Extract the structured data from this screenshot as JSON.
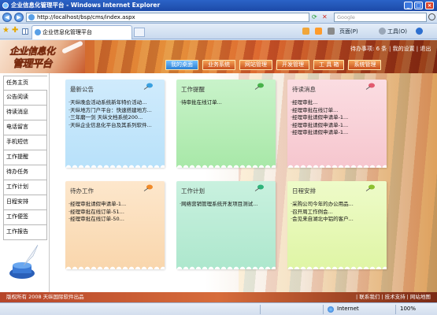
{
  "window": {
    "title": "企业信息化管理平台 - Windows Internet Explorer",
    "address": "http://localhost/bsp/cms/index.aspx",
    "search_placeholder": "Google",
    "tab_title": "企业信息化管理平台",
    "commands": {
      "page": "页面(P)",
      "tools": "工具(O)"
    },
    "status": {
      "zone": "Internet",
      "zoom": "100%"
    }
  },
  "header": {
    "logo_line1": "企业信息化",
    "logo_line2": "管理平台",
    "user_count_label": "待办事项: 6 条",
    "links": "| 我的设置 | 退出"
  },
  "nav": [
    {
      "label": "我的桌面",
      "active": true
    },
    {
      "label": "业务系统",
      "active": false
    },
    {
      "label": "网站管理",
      "active": false
    },
    {
      "label": "开发管理",
      "active": false
    },
    {
      "label": "工 具 箱",
      "active": false
    },
    {
      "label": "系统管理",
      "active": false
    }
  ],
  "sidebar": [
    "任务主页",
    "公告阅读",
    "待读消息",
    "电话留言",
    "手机短信",
    "工作提醒",
    "待办任务",
    "工作计划",
    "日程安排",
    "工作便签",
    "工作报告"
  ],
  "notes": [
    {
      "title": "最新公告",
      "items": [
        "·天纵晚会活动系统新年特价活动...",
        "·天纵地方门户平台：快速搭建地方...",
        "·三年磨一剑 天纵文档系统200...",
        "·天纵企业信息化平台及其系列软件..."
      ]
    },
    {
      "title": "工作提醒",
      "items": [
        "·待审批在线订单..."
      ]
    },
    {
      "title": "待读消息",
      "items": [
        "·经理审批...",
        "·经理审批在线订单...",
        "·经理审批请假申请单-1...",
        "·经理审批请假申请单-1...",
        "·经理审批请假申请单-1..."
      ]
    },
    {
      "title": "待办工作",
      "items": [
        "·经理审批请假申请单-1...",
        "·经理审批在线订单-51...",
        "·经理审批在线订单-50..."
      ]
    },
    {
      "title": "工作计划",
      "items": [
        "·网络营销管理系统开发项目测试..."
      ]
    },
    {
      "title": "日程安排",
      "items": [
        "·采购公司今年的办公用品...",
        "·召开周工作例会...",
        "·会见来自湖北中铝的客户..."
      ]
    }
  ],
  "footer": {
    "left": "版权所有 2008    天纵国际软件出品",
    "right": "| 联系我们 | 技术支持 | 网站地图"
  },
  "colors": {
    "titlebar": "#2b63c7",
    "header_orange": "#d5582d",
    "nav_active": "#2a7fd4"
  }
}
